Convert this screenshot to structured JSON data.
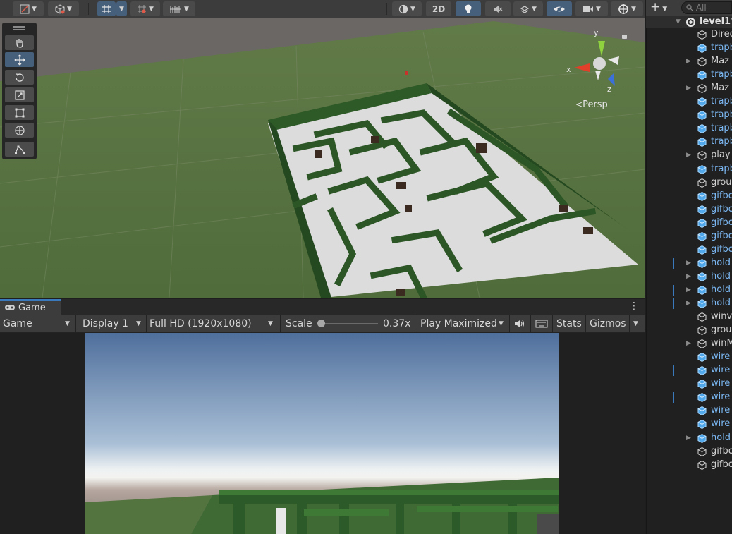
{
  "scene_view": {
    "toolbar": {
      "icons": [
        "draw-mode-icon",
        "shading-icon",
        "grid-snap-icon",
        "snap-increment-icon",
        "render-debug-icon",
        "orientation-icon",
        "lighting-icon",
        "audio-icon",
        "effects-icon",
        "visibility-icon",
        "camera-icon",
        "gizmo-icon"
      ],
      "mode_2d_label": "2D"
    },
    "tools": [
      "hand-tool-icon",
      "move-tool-icon",
      "rotate-tool-icon",
      "scale-tool-icon",
      "rect-tool-icon",
      "transform-tool-icon",
      "custom-tool-icon"
    ],
    "active_tool": "move-tool-icon",
    "gizmo": {
      "x_label": "x",
      "y_label": "y",
      "z_label": "z",
      "projection_label": "Persp"
    }
  },
  "game_view": {
    "tab_label": "Game",
    "menu_icon": "⋮",
    "toolbar": {
      "view_select": "Game",
      "display_select": "Display 1",
      "resolution_select": "Full HD (1920x1080)",
      "scale_label": "Scale",
      "scale_value": "0.37x",
      "scale_fraction": 0.0,
      "play_mode_select": "Play Maximized",
      "stats_label": "Stats",
      "gizmos_label": "Gizmos"
    }
  },
  "hierarchy": {
    "add_label": "+",
    "search_placeholder": "All",
    "scene_name": "level1*",
    "rows": [
      {
        "label": "Direc",
        "prefab": false,
        "expandable": false,
        "marked": false
      },
      {
        "label": "trapb",
        "prefab": true,
        "expandable": false,
        "marked": false
      },
      {
        "label": "Maz",
        "prefab": false,
        "expandable": true,
        "marked": false
      },
      {
        "label": "trapb",
        "prefab": true,
        "expandable": false,
        "marked": false
      },
      {
        "label": "Maz",
        "prefab": false,
        "expandable": true,
        "marked": false
      },
      {
        "label": "trapb",
        "prefab": true,
        "expandable": false,
        "marked": false
      },
      {
        "label": "trapb",
        "prefab": true,
        "expandable": false,
        "marked": false
      },
      {
        "label": "trapb",
        "prefab": true,
        "expandable": false,
        "marked": false
      },
      {
        "label": "trapb",
        "prefab": true,
        "expandable": false,
        "marked": false
      },
      {
        "label": "play",
        "prefab": false,
        "expandable": true,
        "marked": false
      },
      {
        "label": "trapb",
        "prefab": true,
        "expandable": false,
        "marked": false
      },
      {
        "label": "grou",
        "prefab": false,
        "expandable": false,
        "marked": false
      },
      {
        "label": "gifbo",
        "prefab": true,
        "expandable": false,
        "marked": false
      },
      {
        "label": "gifbo",
        "prefab": true,
        "expandable": false,
        "marked": false
      },
      {
        "label": "gifbo",
        "prefab": true,
        "expandable": false,
        "marked": false
      },
      {
        "label": "gifbo",
        "prefab": true,
        "expandable": false,
        "marked": false
      },
      {
        "label": "gifbo",
        "prefab": true,
        "expandable": false,
        "marked": false
      },
      {
        "label": "hold",
        "prefab": true,
        "expandable": true,
        "marked": true
      },
      {
        "label": "hold",
        "prefab": true,
        "expandable": true,
        "marked": false
      },
      {
        "label": "hold",
        "prefab": true,
        "expandable": true,
        "marked": true
      },
      {
        "label": "hold",
        "prefab": true,
        "expandable": true,
        "marked": true
      },
      {
        "label": "winv",
        "prefab": false,
        "expandable": false,
        "marked": false
      },
      {
        "label": "grou",
        "prefab": false,
        "expandable": false,
        "marked": false
      },
      {
        "label": "winM",
        "prefab": false,
        "expandable": true,
        "marked": false
      },
      {
        "label": "wire",
        "prefab": true,
        "expandable": false,
        "marked": false
      },
      {
        "label": "wire",
        "prefab": true,
        "expandable": false,
        "marked": true
      },
      {
        "label": "wire",
        "prefab": true,
        "expandable": false,
        "marked": false
      },
      {
        "label": "wire",
        "prefab": true,
        "expandable": false,
        "marked": true
      },
      {
        "label": "wire",
        "prefab": true,
        "expandable": false,
        "marked": false
      },
      {
        "label": "wire",
        "prefab": true,
        "expandable": false,
        "marked": false
      },
      {
        "label": "hold",
        "prefab": true,
        "expandable": true,
        "marked": false
      },
      {
        "label": "gifbo",
        "prefab": false,
        "expandable": false,
        "marked": false
      },
      {
        "label": "gifbo",
        "prefab": false,
        "expandable": false,
        "marked": false
      }
    ]
  },
  "colors": {
    "accent": "#3a79bb",
    "active_tool": "#46607c",
    "prefab_text": "#7bb7f2",
    "hedge": "#2f5a2a",
    "grass": "#5e7a45"
  }
}
